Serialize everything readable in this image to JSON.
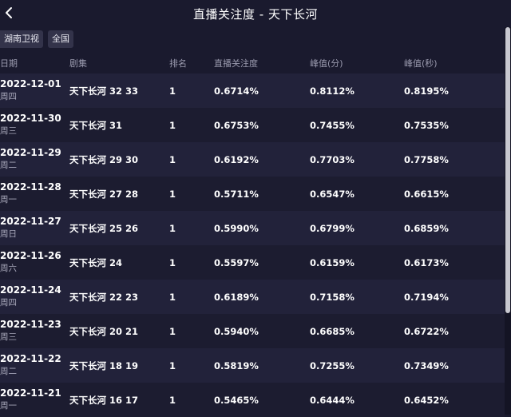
{
  "header": {
    "title": "直播关注度 - 天下长河"
  },
  "filters": [
    {
      "label": "湖南卫视"
    },
    {
      "label": "全国"
    }
  ],
  "columns": {
    "date": "日期",
    "show": "剧集",
    "rank": "排名",
    "attention": "直播关注度",
    "peak_min": "峰值(分)",
    "peak_sec": "峰值(秒)"
  },
  "rows": [
    {
      "date": "2022-12-01",
      "weekday": "周四",
      "show": "天下长河 32 33",
      "rank": "1",
      "attention": "0.6714%",
      "peak_min": "0.8112%",
      "peak_sec": "0.8195%"
    },
    {
      "date": "2022-11-30",
      "weekday": "周三",
      "show": "天下长河 31",
      "rank": "1",
      "attention": "0.6753%",
      "peak_min": "0.7455%",
      "peak_sec": "0.7535%"
    },
    {
      "date": "2022-11-29",
      "weekday": "周二",
      "show": "天下长河 29 30",
      "rank": "1",
      "attention": "0.6192%",
      "peak_min": "0.7703%",
      "peak_sec": "0.7758%"
    },
    {
      "date": "2022-11-28",
      "weekday": "周一",
      "show": "天下长河 27 28",
      "rank": "1",
      "attention": "0.5711%",
      "peak_min": "0.6547%",
      "peak_sec": "0.6615%"
    },
    {
      "date": "2022-11-27",
      "weekday": "周日",
      "show": "天下长河 25 26",
      "rank": "1",
      "attention": "0.5990%",
      "peak_min": "0.6799%",
      "peak_sec": "0.6859%"
    },
    {
      "date": "2022-11-26",
      "weekday": "周六",
      "show": "天下长河 24",
      "rank": "1",
      "attention": "0.5597%",
      "peak_min": "0.6159%",
      "peak_sec": "0.6173%"
    },
    {
      "date": "2022-11-24",
      "weekday": "周四",
      "show": "天下长河 22 23",
      "rank": "1",
      "attention": "0.6189%",
      "peak_min": "0.7158%",
      "peak_sec": "0.7194%"
    },
    {
      "date": "2022-11-23",
      "weekday": "周三",
      "show": "天下长河 20 21",
      "rank": "1",
      "attention": "0.5940%",
      "peak_min": "0.6685%",
      "peak_sec": "0.6722%"
    },
    {
      "date": "2022-11-22",
      "weekday": "周二",
      "show": "天下长河 18 19",
      "rank": "1",
      "attention": "0.5819%",
      "peak_min": "0.7255%",
      "peak_sec": "0.7349%"
    },
    {
      "date": "2022-11-21",
      "weekday": "周一",
      "show": "天下长河 16 17",
      "rank": "1",
      "attention": "0.5465%",
      "peak_min": "0.6444%",
      "peak_sec": "0.6452%"
    }
  ]
}
